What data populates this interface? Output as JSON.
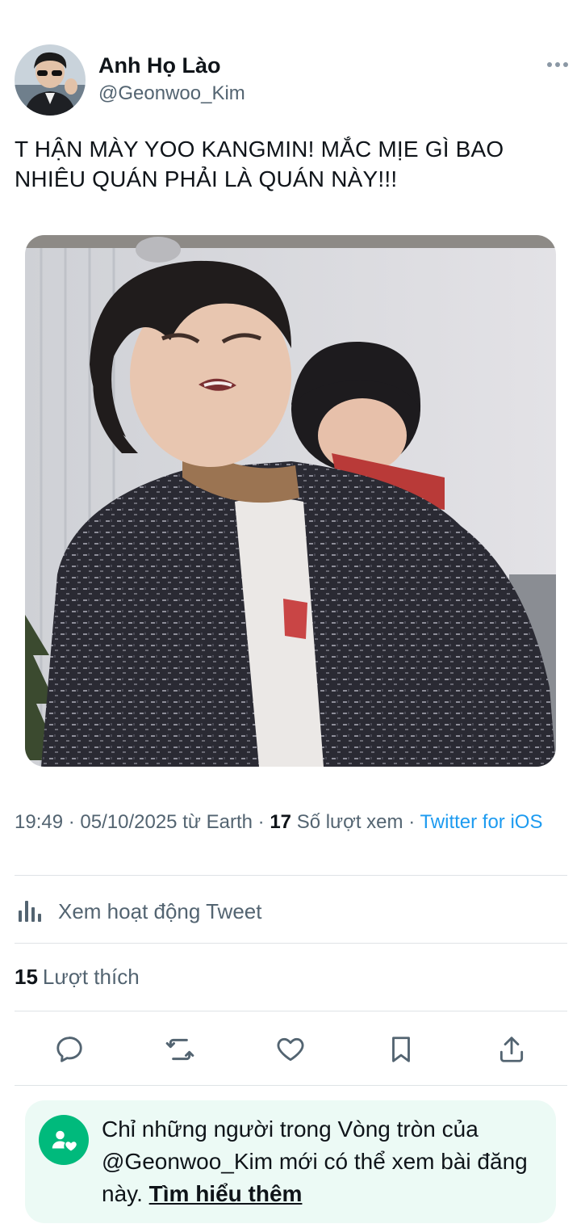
{
  "tweet": {
    "author_name": "Anh Họ Lào",
    "author_handle": "@Geonwoo_Kim",
    "text": "T HẬN MÀY YOO KANGMIN! MẮC MỊE GÌ BAO NHIÊU QUÁN PHẢI LÀ QUÁN NÀY!!!",
    "media_alt": "photo"
  },
  "meta": {
    "time": "19:49",
    "date": "05/10/2025",
    "from": "từ Earth",
    "views_count": "17",
    "views_label": "Số lượt xem",
    "source": "Twitter for iOS"
  },
  "activity": {
    "label": "Xem hoạt động Tweet",
    "icon": "analytics-icon"
  },
  "likes": {
    "count": "15",
    "label": "Lượt thích"
  },
  "actions": {
    "reply_icon": "reply-icon",
    "retweet_icon": "retweet-icon",
    "like_icon": "heart-icon",
    "bookmark_icon": "bookmark-icon",
    "share_icon": "share-icon"
  },
  "circle_notice": {
    "text_before": "Chỉ những người trong Vòng tròn của @Geonwoo_Kim mới có thể xem bài đăng này.",
    "link_text": "Tìm hiểu thêm",
    "accent_color": "#00ba7c"
  }
}
